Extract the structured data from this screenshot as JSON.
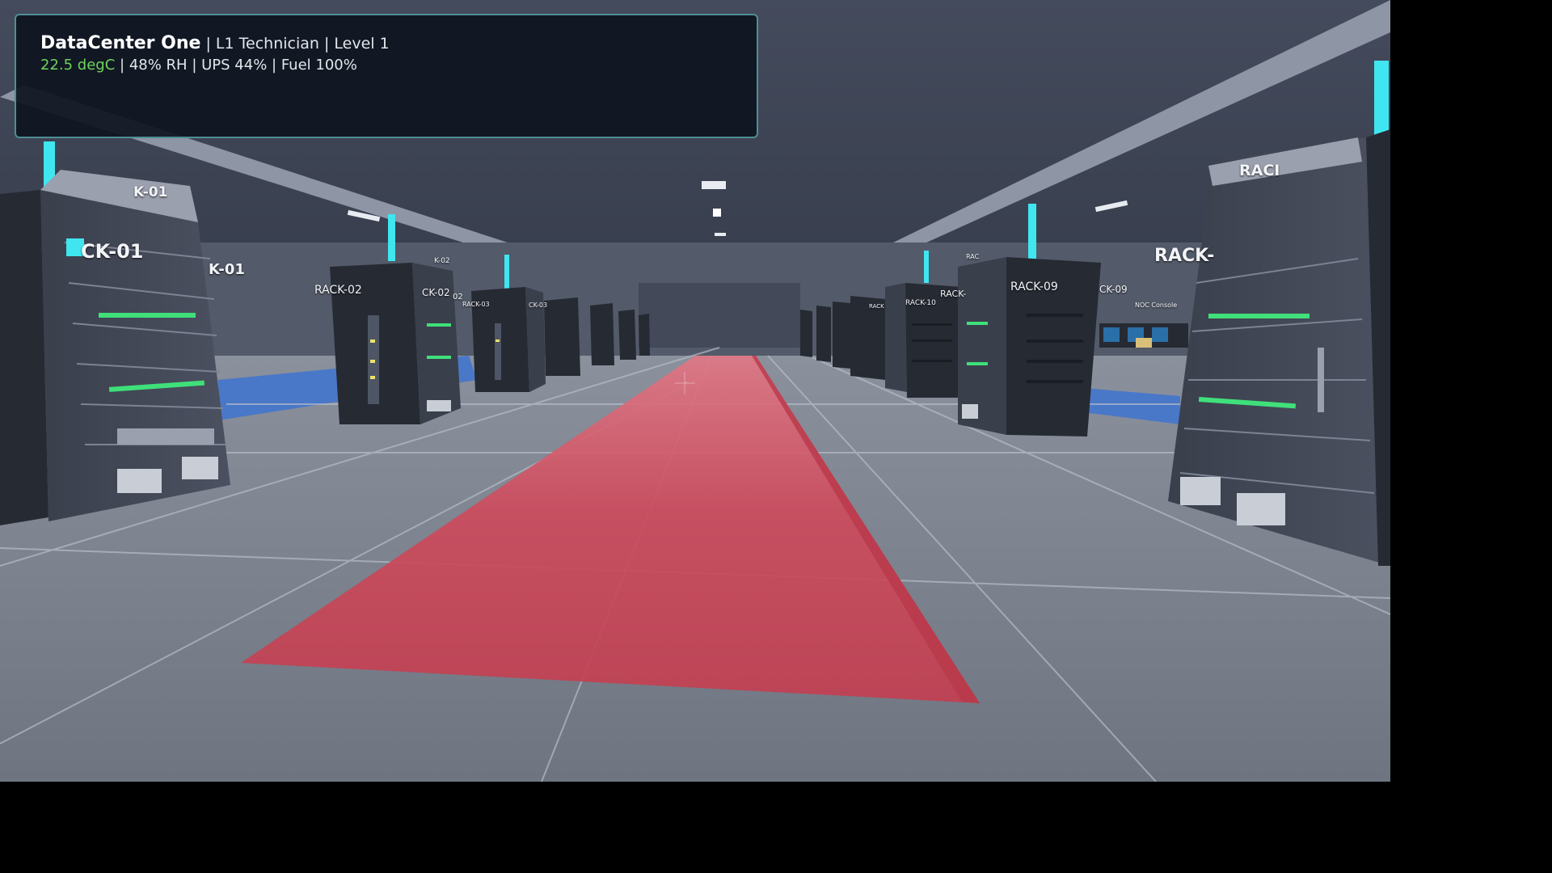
{
  "hud": {
    "facility": "DataCenter One",
    "sep": " | ",
    "role": "L1 Technician",
    "level": "Level 1",
    "temperature": "22.5 degC",
    "humidity": "48% RH",
    "ups": "UPS 44%",
    "fuel": "Fuel 100%"
  },
  "colors": {
    "temperature_ok": "#6fd35a",
    "path_highlight": "#cf4a5a",
    "accent_light": "#3fe6f0",
    "status_led": "#3fe07a"
  },
  "rack_labels": {
    "l1": "K-01",
    "l2": "CK-01",
    "l3": "K-01",
    "l4": "RACK-02",
    "l5": "CK-02",
    "l6": "K-02",
    "l7": "02",
    "l8": "RACK-03",
    "l9": "CK-03",
    "l10": "RACK-09",
    "l11": "RACK-10",
    "l12": "RACK-",
    "l13": "CK-09",
    "l14": "RACK-",
    "l15": "RACI",
    "l16": "RACK",
    "l17": "RAC",
    "l18": "NOC Console"
  },
  "icons": {
    "crosshair": "crosshair-icon"
  }
}
